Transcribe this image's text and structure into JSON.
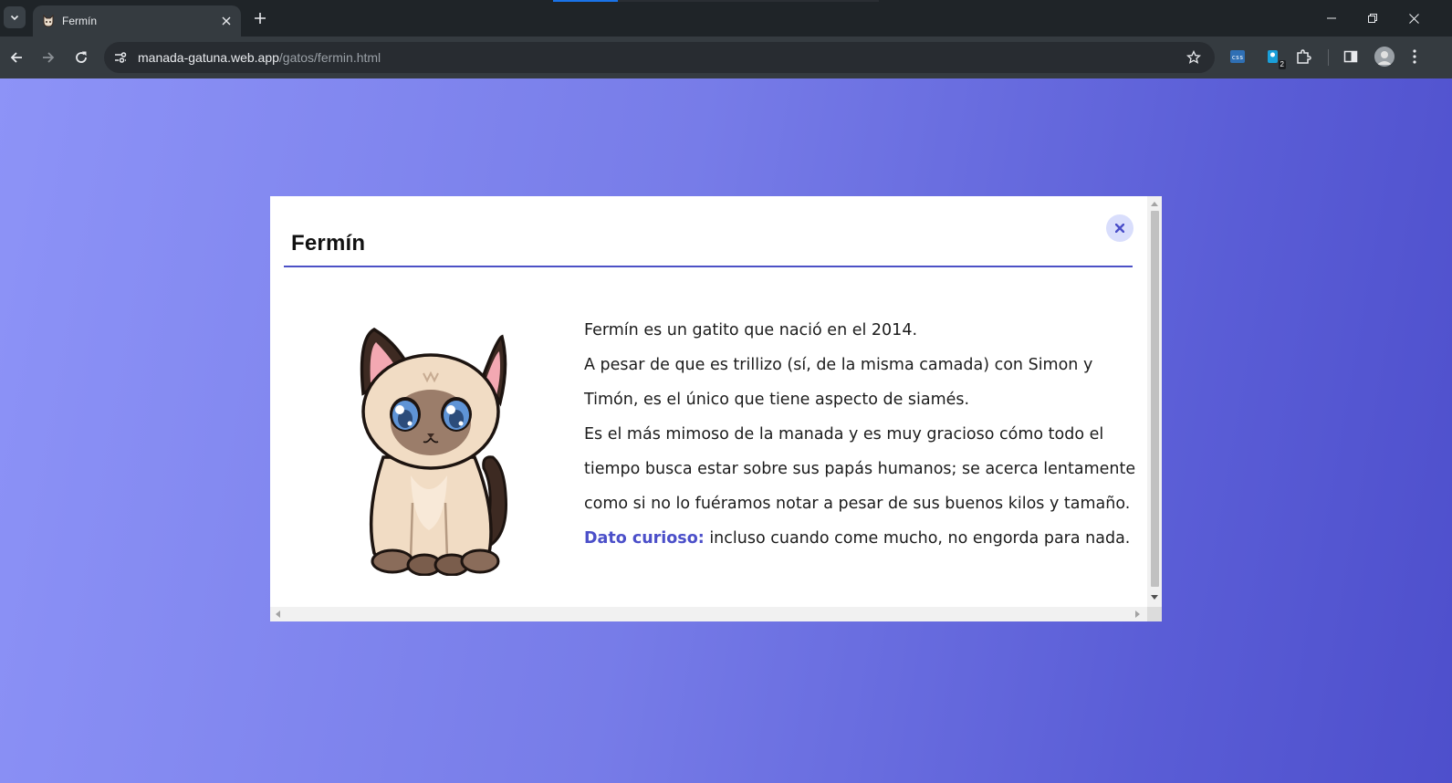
{
  "browser": {
    "tab": {
      "title": "Fermín",
      "favicon": "cat-favicon-icon"
    },
    "url": {
      "host": "manada-gatuna.web.app",
      "path": "/gatos/fermin.html"
    },
    "loading_progress": 0.2,
    "extension_badge": "2",
    "accent": "#1a73e8"
  },
  "modal": {
    "title": "Fermín",
    "paragraphs": [
      "Fermín es un gatito que nació en el 2014.",
      "A pesar de que es trillizo (sí, de la misma camada) con Simon y Timón, es el único que tiene aspecto de siamés.",
      "Es el más mimoso de la manada y es muy gracioso cómo todo el tiempo busca estar sobre sus papás humanos; se acerca lentamente como si no lo fuéramos notar a pesar de sus buenos kilos y tamaño."
    ],
    "fun_fact_label": "Dato curioso:",
    "fun_fact_text": " incluso cuando come mucho, no engorda para nada.",
    "accent_color": "#4c51c6",
    "close_icon": "close-icon"
  }
}
